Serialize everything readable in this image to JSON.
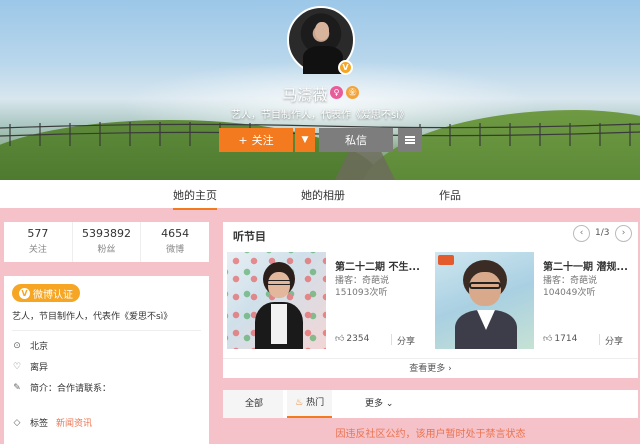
{
  "profile": {
    "name": "马濤薇",
    "description": "艺人，节目制作人，代表作《爱思不sì》",
    "verified_badge": "V",
    "name_icon_1": "♀",
    "name_icon_2": "㊎"
  },
  "actions": {
    "follow_label": "关注",
    "follow_plus": "+",
    "dropdown_arrow": "▼",
    "message_label": "私信"
  },
  "tabs": [
    {
      "label": "她的主页",
      "active": true
    },
    {
      "label": "她的相册",
      "active": false
    },
    {
      "label": "作品",
      "active": false
    }
  ],
  "stats": [
    {
      "value": "577",
      "label": "关注"
    },
    {
      "value": "5393892",
      "label": "粉丝"
    },
    {
      "value": "4654",
      "label": "微博"
    }
  ],
  "info": {
    "verify_label": "微博认证",
    "verify_icon": "V",
    "intro": "艺人，节目制作人，代表作《爱思不sì》",
    "location": "北京",
    "relationship": "离异",
    "bio": "简介：合作请联系：",
    "tags_label": "标签",
    "tags_value": "新闻资讯"
  },
  "listen": {
    "title": "听节目",
    "pager_text": "1/3",
    "prev": "‹",
    "next": "›",
    "cards": [
      {
        "title": "第二十二期 不生...",
        "host": "播客：奇葩说",
        "plays": "151093次听",
        "likes": "2354",
        "share": "分享"
      },
      {
        "title": "第二十一期 潜规...",
        "host": "播客：奇葩说",
        "plays": "104049次听",
        "likes": "1714",
        "share": "分享"
      }
    ],
    "more": "查看更多 ›"
  },
  "feed_filter": {
    "all": "全部",
    "hot": "热门",
    "more": "更多 ⌄"
  },
  "notice": "因违反社区公约，该用户暂时处于禁言状态",
  "colors": {
    "accent": "#f37a1f",
    "background": "#f4c2c8",
    "verify": "#f6a623"
  }
}
